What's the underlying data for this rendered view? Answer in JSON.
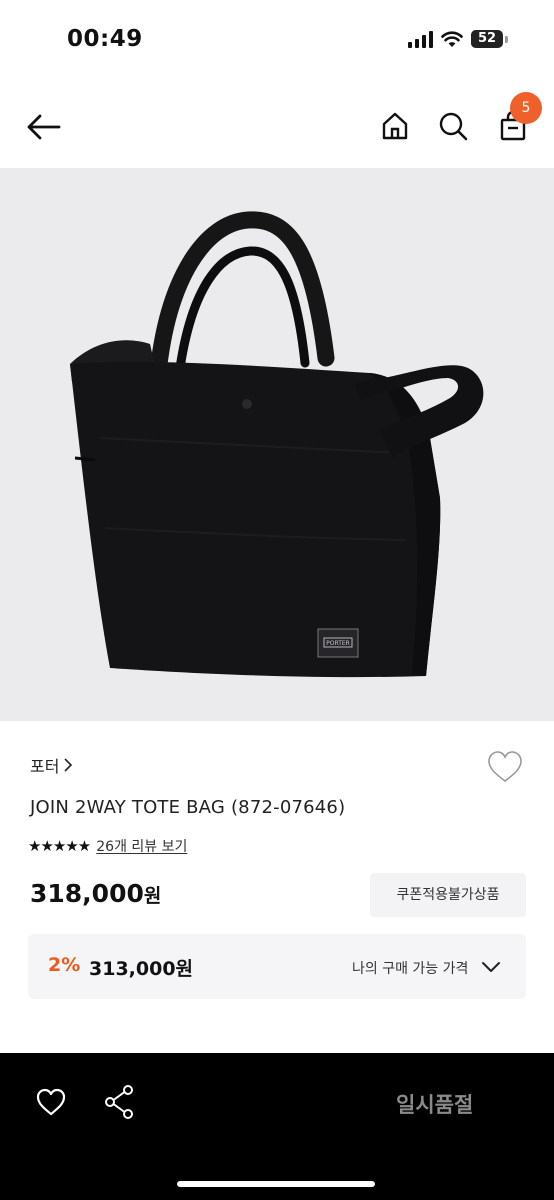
{
  "status": {
    "time": "00:49",
    "battery": "52"
  },
  "header": {
    "cart_count": "5"
  },
  "product": {
    "brand": "포터",
    "name": "JOIN 2WAY TOTE BAG (872-07646)",
    "rating_stars": "★★★★★",
    "review_link": "26개 리뷰 보기",
    "price": "318,000",
    "price_unit": "원",
    "coupon_label": "쿠폰적용불가상품",
    "label_logo": "PORTER"
  },
  "my_price": {
    "discount": "2%",
    "price": "313,000",
    "price_unit": "원",
    "label": "나의 구매 가능 가격"
  },
  "bottom": {
    "soldout_label": "일시품절"
  },
  "icons": {
    "back": "arrow-left-icon",
    "home": "home-icon",
    "search": "search-icon",
    "bag": "shopping-bag-icon",
    "wish": "heart-icon",
    "share": "share-icon",
    "expand": "chevron-down-icon"
  },
  "colors": {
    "accent": "#f0602a",
    "discount": "#ea5b1d",
    "image_bg": "#ebebed",
    "bottom_bar": "#000000"
  }
}
